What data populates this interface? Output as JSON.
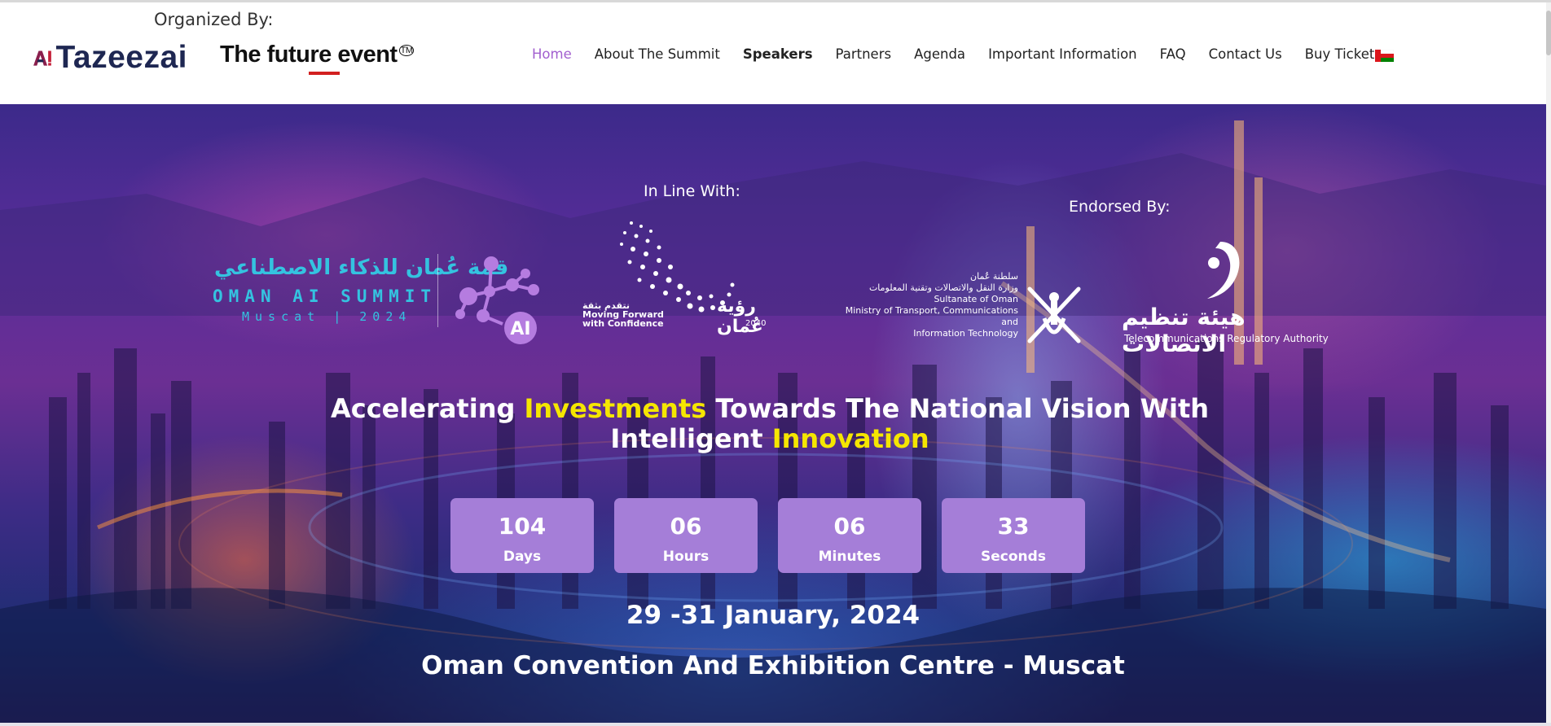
{
  "header": {
    "organized_by": "Organized By:",
    "logo_primary": "Tazeezai",
    "logo_secondary": "The future event",
    "logo_secondary_mark": "TM"
  },
  "nav": {
    "items": [
      {
        "label": "Home",
        "state": "active"
      },
      {
        "label": "About The Summit"
      },
      {
        "label": "Speakers",
        "state": "bold"
      },
      {
        "label": "Partners"
      },
      {
        "label": "Agenda"
      },
      {
        "label": "Important Information"
      },
      {
        "label": "FAQ"
      },
      {
        "label": "Contact Us"
      },
      {
        "label": "Buy Ticket"
      }
    ],
    "flag_icon": "oman-flag-icon",
    "active_color": "#a25fcf"
  },
  "hero": {
    "in_line_with": "In Line With:",
    "endorsed_by": "Endorsed By:",
    "summit_logo": {
      "arabic": "قمة عُمان للذكاء الاصطناعي",
      "english": "OMAN AI SUMMIT",
      "subtitle": "Muscat | 2024",
      "badge": "AI"
    },
    "vision_logo": {
      "arabic_small": "نتقدم بثقة",
      "tagline_1": "Moving Forward",
      "tagline_2": "with Confidence",
      "arabic": "رؤية عُمان",
      "year": "2040"
    },
    "ministry_logo": {
      "arabic_1": "سلطنة عُمان",
      "arabic_2": "وزارة النقل والاتصالات وتقنية المعلومات",
      "line_1": "Sultanate of Oman",
      "line_2": "Ministry of Transport, Communications and",
      "line_3": "Information Technology"
    },
    "tra_logo": {
      "arabic": "هيئة تنظيم الاتصالات",
      "english": "Telecommunications Regulatory Authority"
    },
    "headline": {
      "part1": "Accelerating ",
      "highlight1": "Investments",
      "part2": " Towards The National Vision With",
      "part3": "Intelligent ",
      "highlight2": "Innovation"
    },
    "countdown": [
      {
        "value": "104",
        "label": "Days"
      },
      {
        "value": "06",
        "label": "Hours"
      },
      {
        "value": "06",
        "label": "Minutes"
      },
      {
        "value": "33",
        "label": "Seconds"
      }
    ],
    "date": "29 -31 January, 2024",
    "venue": "Oman Convention And Exhibition Centre - Muscat",
    "highlight_color": "#f5e600",
    "countdown_color": "#a57ed8"
  }
}
